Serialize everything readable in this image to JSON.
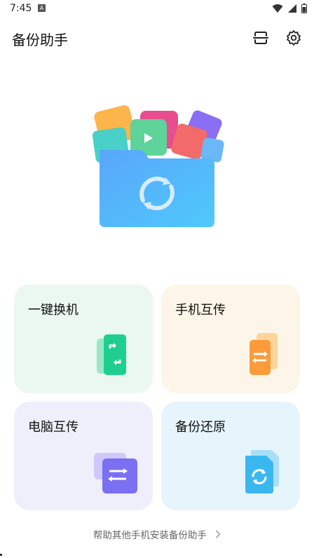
{
  "status_bar": {
    "time": "7:45",
    "notification_badge": "A"
  },
  "header": {
    "title": "备份助手"
  },
  "cards": [
    {
      "label": "一键换机",
      "icon": "phone-swap-icon",
      "color": "#1fcf8f"
    },
    {
      "label": "手机互传",
      "icon": "phone-transfer-icon",
      "color": "#fb9b3a"
    },
    {
      "label": "电脑互传",
      "icon": "pc-transfer-icon",
      "color": "#7b6ff2"
    },
    {
      "label": "备份还原",
      "icon": "backup-restore-icon",
      "color": "#3bb7f0"
    }
  ],
  "footer": {
    "help_link": "帮助其他手机安装备份助手"
  }
}
